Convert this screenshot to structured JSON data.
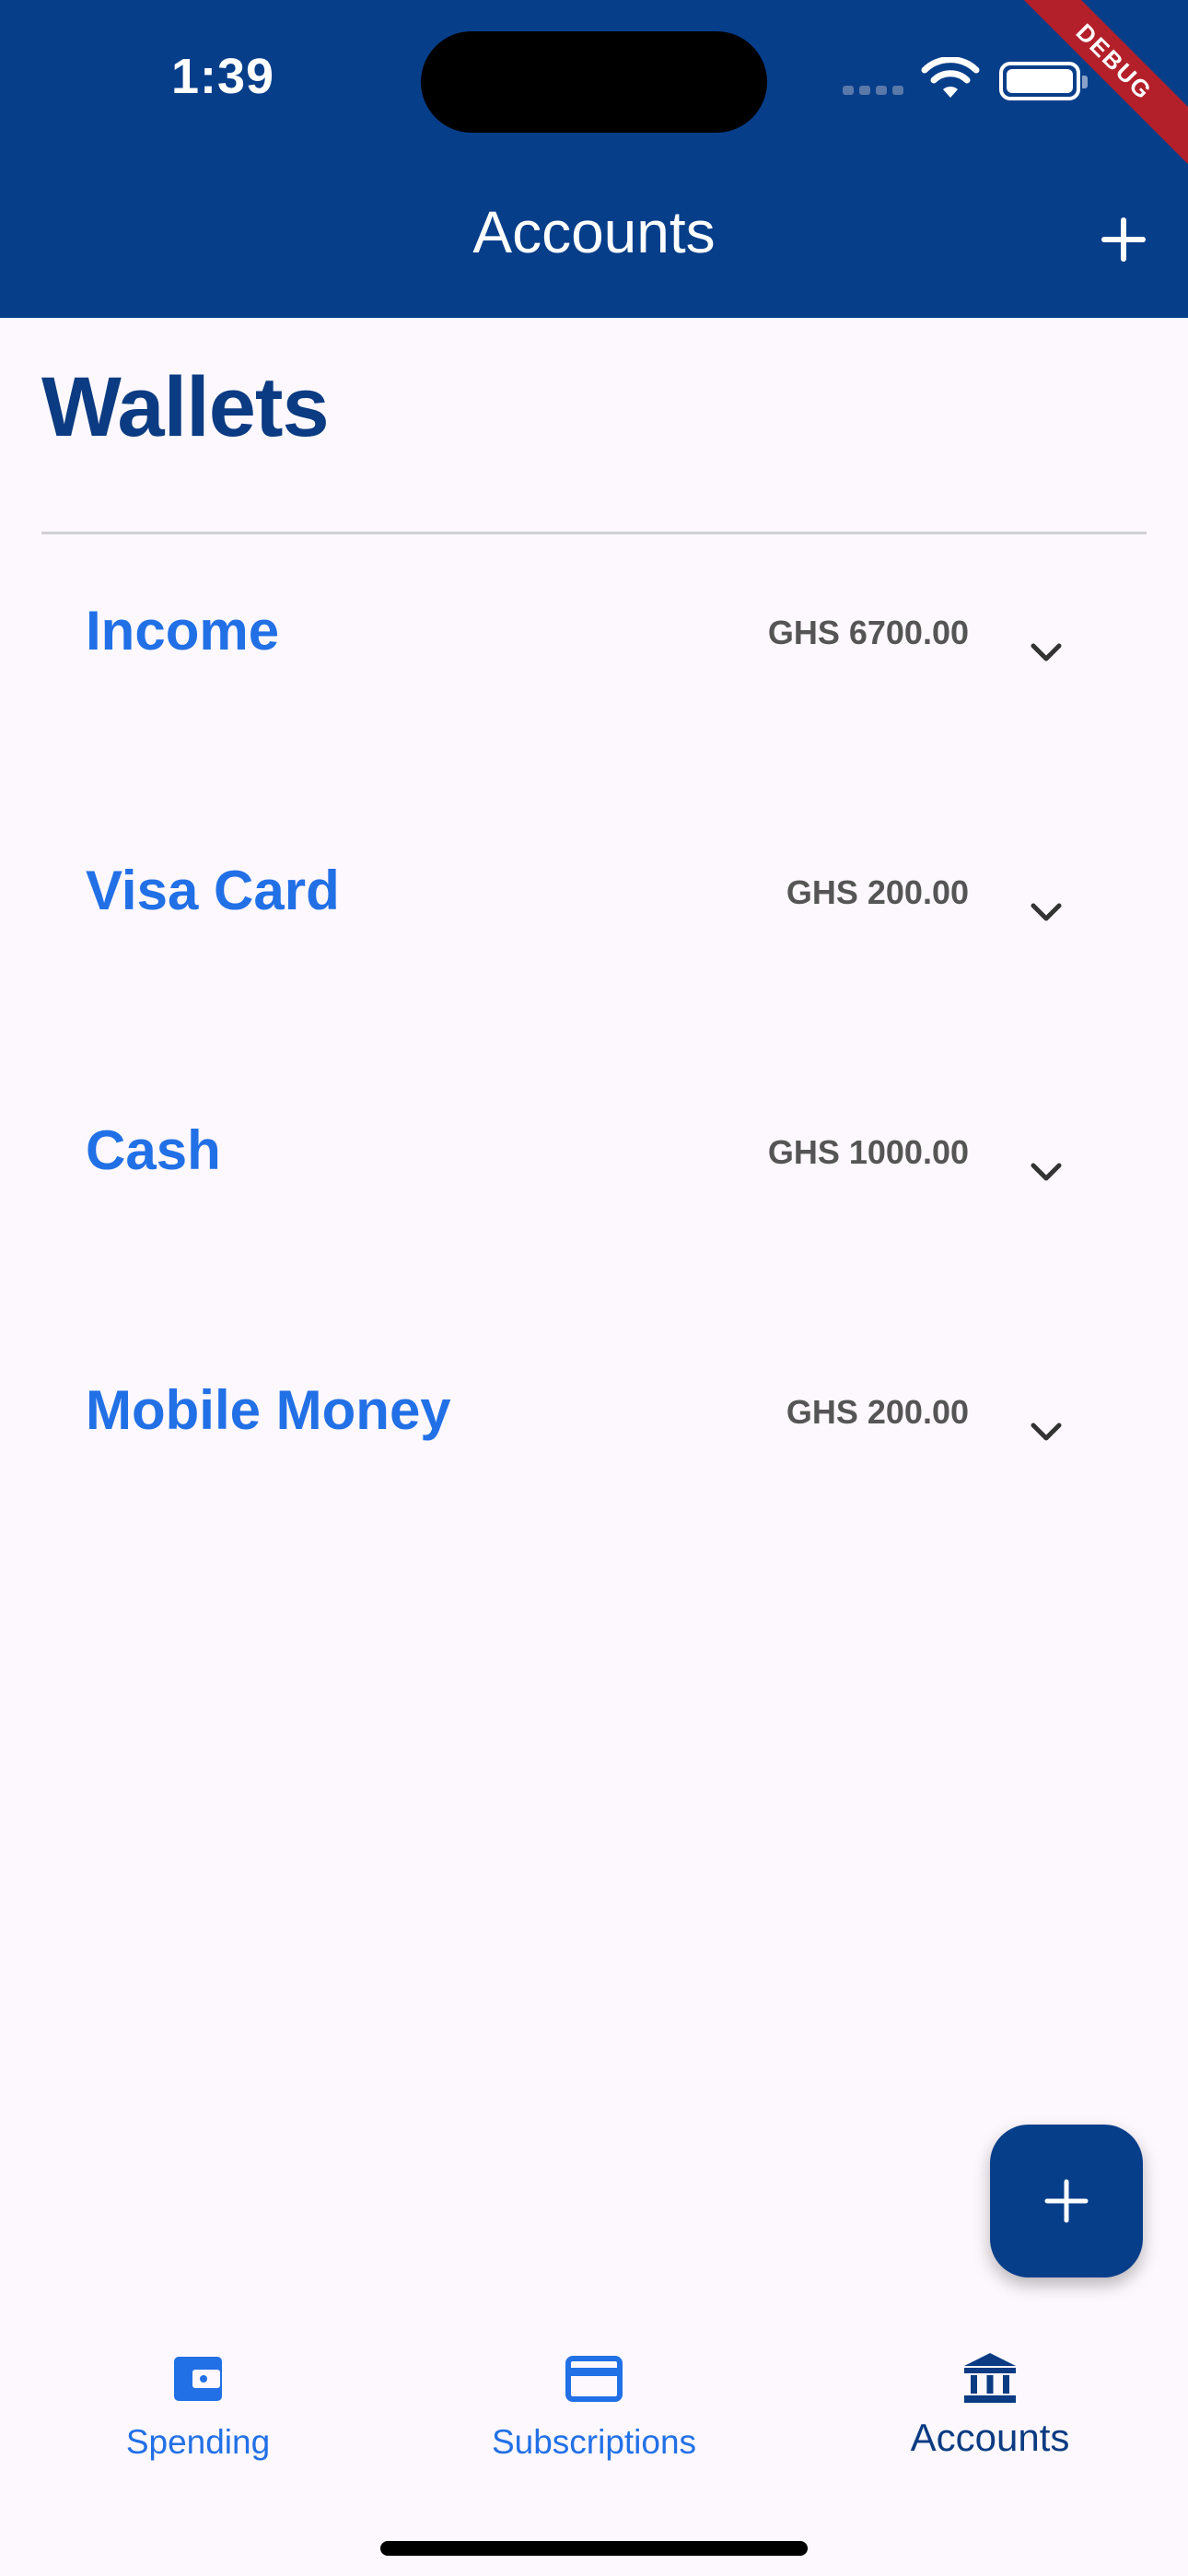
{
  "status_bar": {
    "time": "1:39"
  },
  "debug_banner": "DEBUG",
  "app_bar": {
    "title": "Accounts",
    "add_icon": "plus-icon"
  },
  "section": {
    "title": "Wallets"
  },
  "wallets": [
    {
      "name": "Income",
      "balance": "GHS 6700.00"
    },
    {
      "name": "Visa Card",
      "balance": "GHS 200.00"
    },
    {
      "name": "Cash",
      "balance": "GHS 1000.00"
    },
    {
      "name": "Mobile Money",
      "balance": "GHS 200.00"
    }
  ],
  "fab": {
    "icon": "plus-icon"
  },
  "bottom_nav": {
    "items": [
      {
        "label": "Spending",
        "icon": "wallet-icon",
        "active": false
      },
      {
        "label": "Subscriptions",
        "icon": "credit-card-icon",
        "active": false
      },
      {
        "label": "Accounts",
        "icon": "bank-icon",
        "active": true
      }
    ]
  },
  "colors": {
    "primary": "#073e8a",
    "accent": "#2270e6",
    "background": "#fdf8fd"
  }
}
